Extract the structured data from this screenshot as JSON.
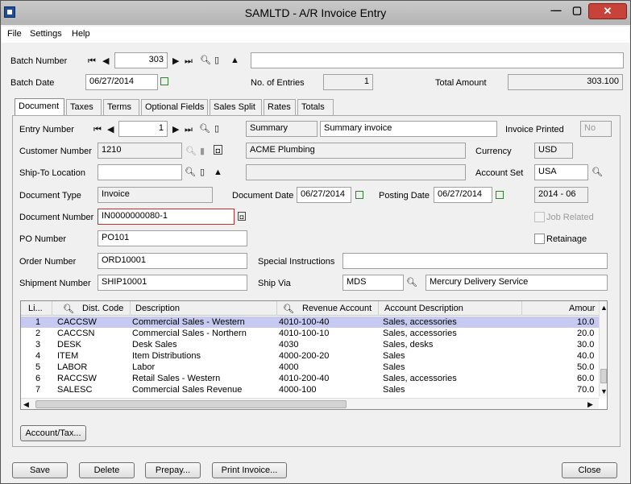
{
  "window": {
    "title": "SAMLTD - A/R Invoice Entry",
    "min": "—",
    "max": "▢",
    "close": "✕"
  },
  "menu": [
    "File",
    "Settings",
    "Help"
  ],
  "batch": {
    "number_label": "Batch Number",
    "number": "303",
    "description": "",
    "date_label": "Batch Date",
    "date": "06/27/2014",
    "entries_label": "No. of Entries",
    "entries": "1",
    "total_label": "Total Amount",
    "total": "303.100"
  },
  "tabs": [
    "Document",
    "Taxes",
    "Terms",
    "Optional Fields",
    "Sales Split",
    "Rates",
    "Totals"
  ],
  "document": {
    "entry_label": "Entry Number",
    "entry": "1",
    "entry_type": "Summary",
    "entry_desc": "Summary invoice",
    "printed_label": "Invoice Printed",
    "printed": "No",
    "customer_label": "Customer Number",
    "customer": "1210",
    "customer_name": "ACME Plumbing",
    "currency_label": "Currency",
    "currency": "USD",
    "shipto_label": "Ship-To Location",
    "shipto": "",
    "shipto_desc": "",
    "account_set_label": "Account Set",
    "account_set": "USA",
    "doc_type_label": "Document Type",
    "doc_type": "Invoice",
    "doc_date_label": "Document Date",
    "doc_date": "06/27/2014",
    "post_date_label": "Posting Date",
    "post_date": "06/27/2014",
    "period": "2014 - 06",
    "doc_number_label": "Document Number",
    "doc_number": "IN0000000080-1",
    "job_related_label": "Job Related",
    "po_label": "PO Number",
    "po": "PO101",
    "retainage_label": "Retainage",
    "order_label": "Order Number",
    "order": "ORD10001",
    "special_label": "Special Instructions",
    "special": "",
    "shipment_label": "Shipment Number",
    "shipment": "SHIP10001",
    "shipvia_label": "Ship Via",
    "shipvia": "MDS",
    "shipvia_desc": "Mercury Delivery Service"
  },
  "grid": {
    "headers": {
      "line": "Li...",
      "dist": "Dist. Code",
      "desc": "Description",
      "rev": "Revenue Account",
      "acct": "Account Description",
      "amt": "Amour"
    },
    "rows": [
      {
        "n": "1",
        "code": "CACCSW",
        "desc": "Commercial Sales - Western",
        "rev": "4010-100-40",
        "acct": "Sales, accessories",
        "amt": "10.0"
      },
      {
        "n": "2",
        "code": "CACCSN",
        "desc": "Commercial Sales - Northern",
        "rev": "4010-100-10",
        "acct": "Sales, accessories",
        "amt": "20.0"
      },
      {
        "n": "3",
        "code": "DESK",
        "desc": "Desk Sales",
        "rev": "4030",
        "acct": "Sales, desks",
        "amt": "30.0"
      },
      {
        "n": "4",
        "code": "ITEM",
        "desc": "Item Distributions",
        "rev": "4000-200-20",
        "acct": "Sales",
        "amt": "40.0"
      },
      {
        "n": "5",
        "code": "LABOR",
        "desc": "Labor",
        "rev": "4000",
        "acct": "Sales",
        "amt": "50.0"
      },
      {
        "n": "6",
        "code": "RACCSW",
        "desc": "Retail Sales - Western",
        "rev": "4010-200-40",
        "acct": "Sales, accessories",
        "amt": "60.0"
      },
      {
        "n": "7",
        "code": "SALESC",
        "desc": "Commercial Sales Revenue",
        "rev": "4000-100",
        "acct": "Sales",
        "amt": "70.0"
      }
    ]
  },
  "buttons": {
    "account_tax": "Account/Tax...",
    "save": "Save",
    "delete": "Delete",
    "prepay": "Prepay...",
    "print": "Print Invoice...",
    "close": "Close"
  },
  "colors": {
    "selected_row": "#c6c9f0",
    "close_button": "#c7433a",
    "error_border": "#c03030"
  }
}
